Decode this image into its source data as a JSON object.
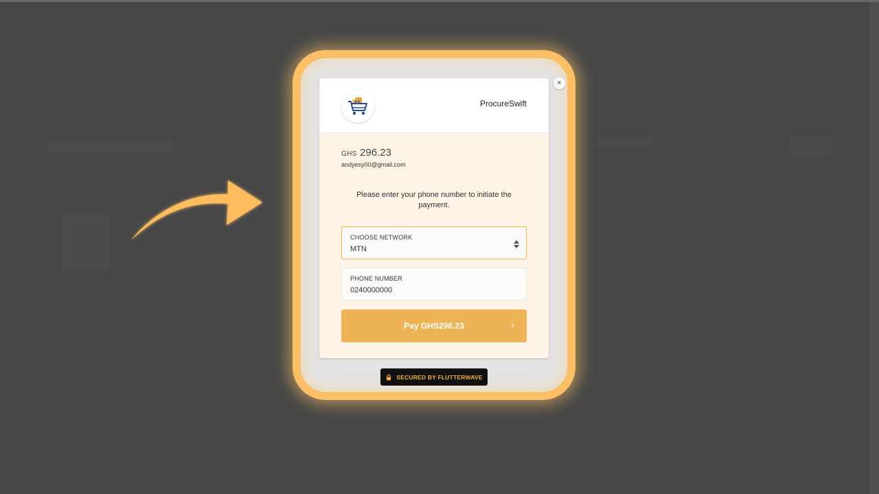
{
  "modal": {
    "merchant_name": "ProcureSwift",
    "currency": "GHS",
    "amount": "296.23",
    "email": "andyesy00@gmail.com",
    "instruction": "Please enter your phone number to initiate the payment.",
    "network_field": {
      "label": "CHOOSE NETWORK",
      "value": "MTN"
    },
    "phone_field": {
      "label": "PHONE NUMBER",
      "value": "0240000000"
    },
    "pay_button": {
      "label": "Pay GHS296.23",
      "chevron": "›"
    },
    "close_symbol": "×"
  },
  "footer": {
    "secured_label": "SECURED BY FLUTTERWAVE"
  },
  "icons": {
    "logo": "shopping-cart-logo-icon",
    "close": "close-icon",
    "select": "sort-arrows-icon",
    "lock": "lock-icon",
    "annotation": "curved-arrow-icon"
  },
  "colors": {
    "accent": "#edb356",
    "highlight": "#ffbf66",
    "background": "#474747",
    "badge_text": "#f3b135"
  }
}
